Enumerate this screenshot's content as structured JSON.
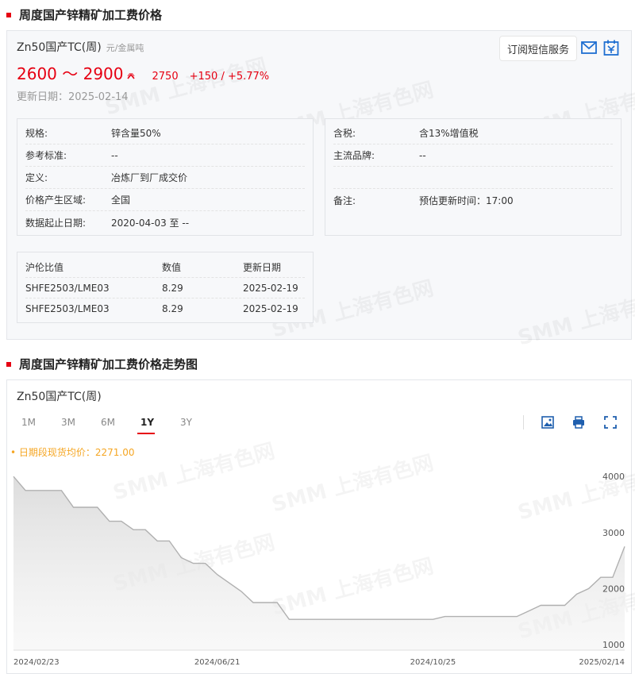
{
  "section1": {
    "title": "周度国产锌精矿加工费价格"
  },
  "product": {
    "name": "Zn50国产TC(周)",
    "unit": "元/金属吨",
    "price_range": "2600 ～ 2900",
    "avg": "2750",
    "change": "+150 / +5.77%",
    "update": "更新日期：2025-02-14"
  },
  "actions": {
    "subscribe": "订阅短信服务",
    "mail_icon": "mail-icon",
    "calendar_icon": "calendar-icon"
  },
  "specs_left": [
    {
      "label": "规格:",
      "value": "锌含量50%"
    },
    {
      "label": "参考标准:",
      "value": "--"
    },
    {
      "label": "定义:",
      "value": "冶炼厂到厂成交价"
    },
    {
      "label": "价格产生区域:",
      "value": "全国"
    },
    {
      "label": "数据起止日期:",
      "value": "2020-04-03 至 --"
    }
  ],
  "specs_right": [
    {
      "label": "含税:",
      "value": "含13%增值税"
    },
    {
      "label": "主流品牌:",
      "value": "--"
    },
    {
      "label": "",
      "value": ""
    },
    {
      "label": "备注:",
      "value": "预估更新时间：17:00"
    }
  ],
  "ratio": {
    "headers": [
      "沪伦比值",
      "数值",
      "更新日期"
    ],
    "rows": [
      [
        "SHFE2503/LME03",
        "8.29",
        "2025-02-19"
      ],
      [
        "SHFE2503/LME03",
        "8.29",
        "2025-02-19"
      ]
    ]
  },
  "section2": {
    "title": "周度国产锌精矿加工费价格走势图"
  },
  "chart_header": {
    "name": "Zn50国产TC(周)",
    "tabs": [
      "1M",
      "3M",
      "6M",
      "1Y",
      "3Y"
    ],
    "active_tab": "1Y",
    "avg_label": "• 日期段现货均价：2271.00",
    "tools": [
      "image-download-icon",
      "print-icon",
      "fullscreen-icon"
    ]
  },
  "watermark": "SMM 上海有色网",
  "colors": {
    "accent": "#e60012",
    "avg": "#f5a623",
    "line": "#b0b0b0"
  },
  "chart_data": {
    "type": "area",
    "title": "Zn50国产TC(周)",
    "ylim": [
      900,
      4300
    ],
    "yticks": [
      1000,
      2000,
      3000,
      4000
    ],
    "xtick_labels": [
      "2024/02/23",
      "2024/06/21",
      "2024/10/25",
      "2025/02/14"
    ],
    "grid": false,
    "x": [
      "2024-02-23",
      "2024-03-01",
      "2024-03-08",
      "2024-03-15",
      "2024-03-22",
      "2024-03-29",
      "2024-04-05",
      "2024-04-12",
      "2024-04-19",
      "2024-04-26",
      "2024-05-03",
      "2024-05-10",
      "2024-05-17",
      "2024-05-24",
      "2024-05-31",
      "2024-06-07",
      "2024-06-14",
      "2024-06-21",
      "2024-06-28",
      "2024-07-05",
      "2024-07-12",
      "2024-07-19",
      "2024-07-26",
      "2024-08-02",
      "2024-08-09",
      "2024-08-16",
      "2024-08-23",
      "2024-08-30",
      "2024-09-06",
      "2024-09-13",
      "2024-09-20",
      "2024-09-27",
      "2024-10-04",
      "2024-10-11",
      "2024-10-18",
      "2024-10-25",
      "2024-11-01",
      "2024-11-08",
      "2024-11-15",
      "2024-11-22",
      "2024-11-29",
      "2024-12-06",
      "2024-12-13",
      "2024-12-20",
      "2024-12-27",
      "2025-01-03",
      "2025-01-10",
      "2025-01-17",
      "2025-01-24",
      "2025-01-31",
      "2025-02-07",
      "2025-02-14"
    ],
    "values": [
      4000,
      3750,
      3750,
      3750,
      3750,
      3450,
      3450,
      3450,
      3200,
      3200,
      3050,
      3050,
      2850,
      2850,
      2550,
      2450,
      2450,
      2250,
      2100,
      1950,
      1750,
      1750,
      1750,
      1450,
      1450,
      1450,
      1450,
      1450,
      1450,
      1450,
      1450,
      1450,
      1450,
      1450,
      1450,
      1450,
      1500,
      1500,
      1500,
      1500,
      1500,
      1500,
      1500,
      1600,
      1700,
      1700,
      1700,
      1900,
      2000,
      2200,
      2200,
      2750
    ]
  }
}
